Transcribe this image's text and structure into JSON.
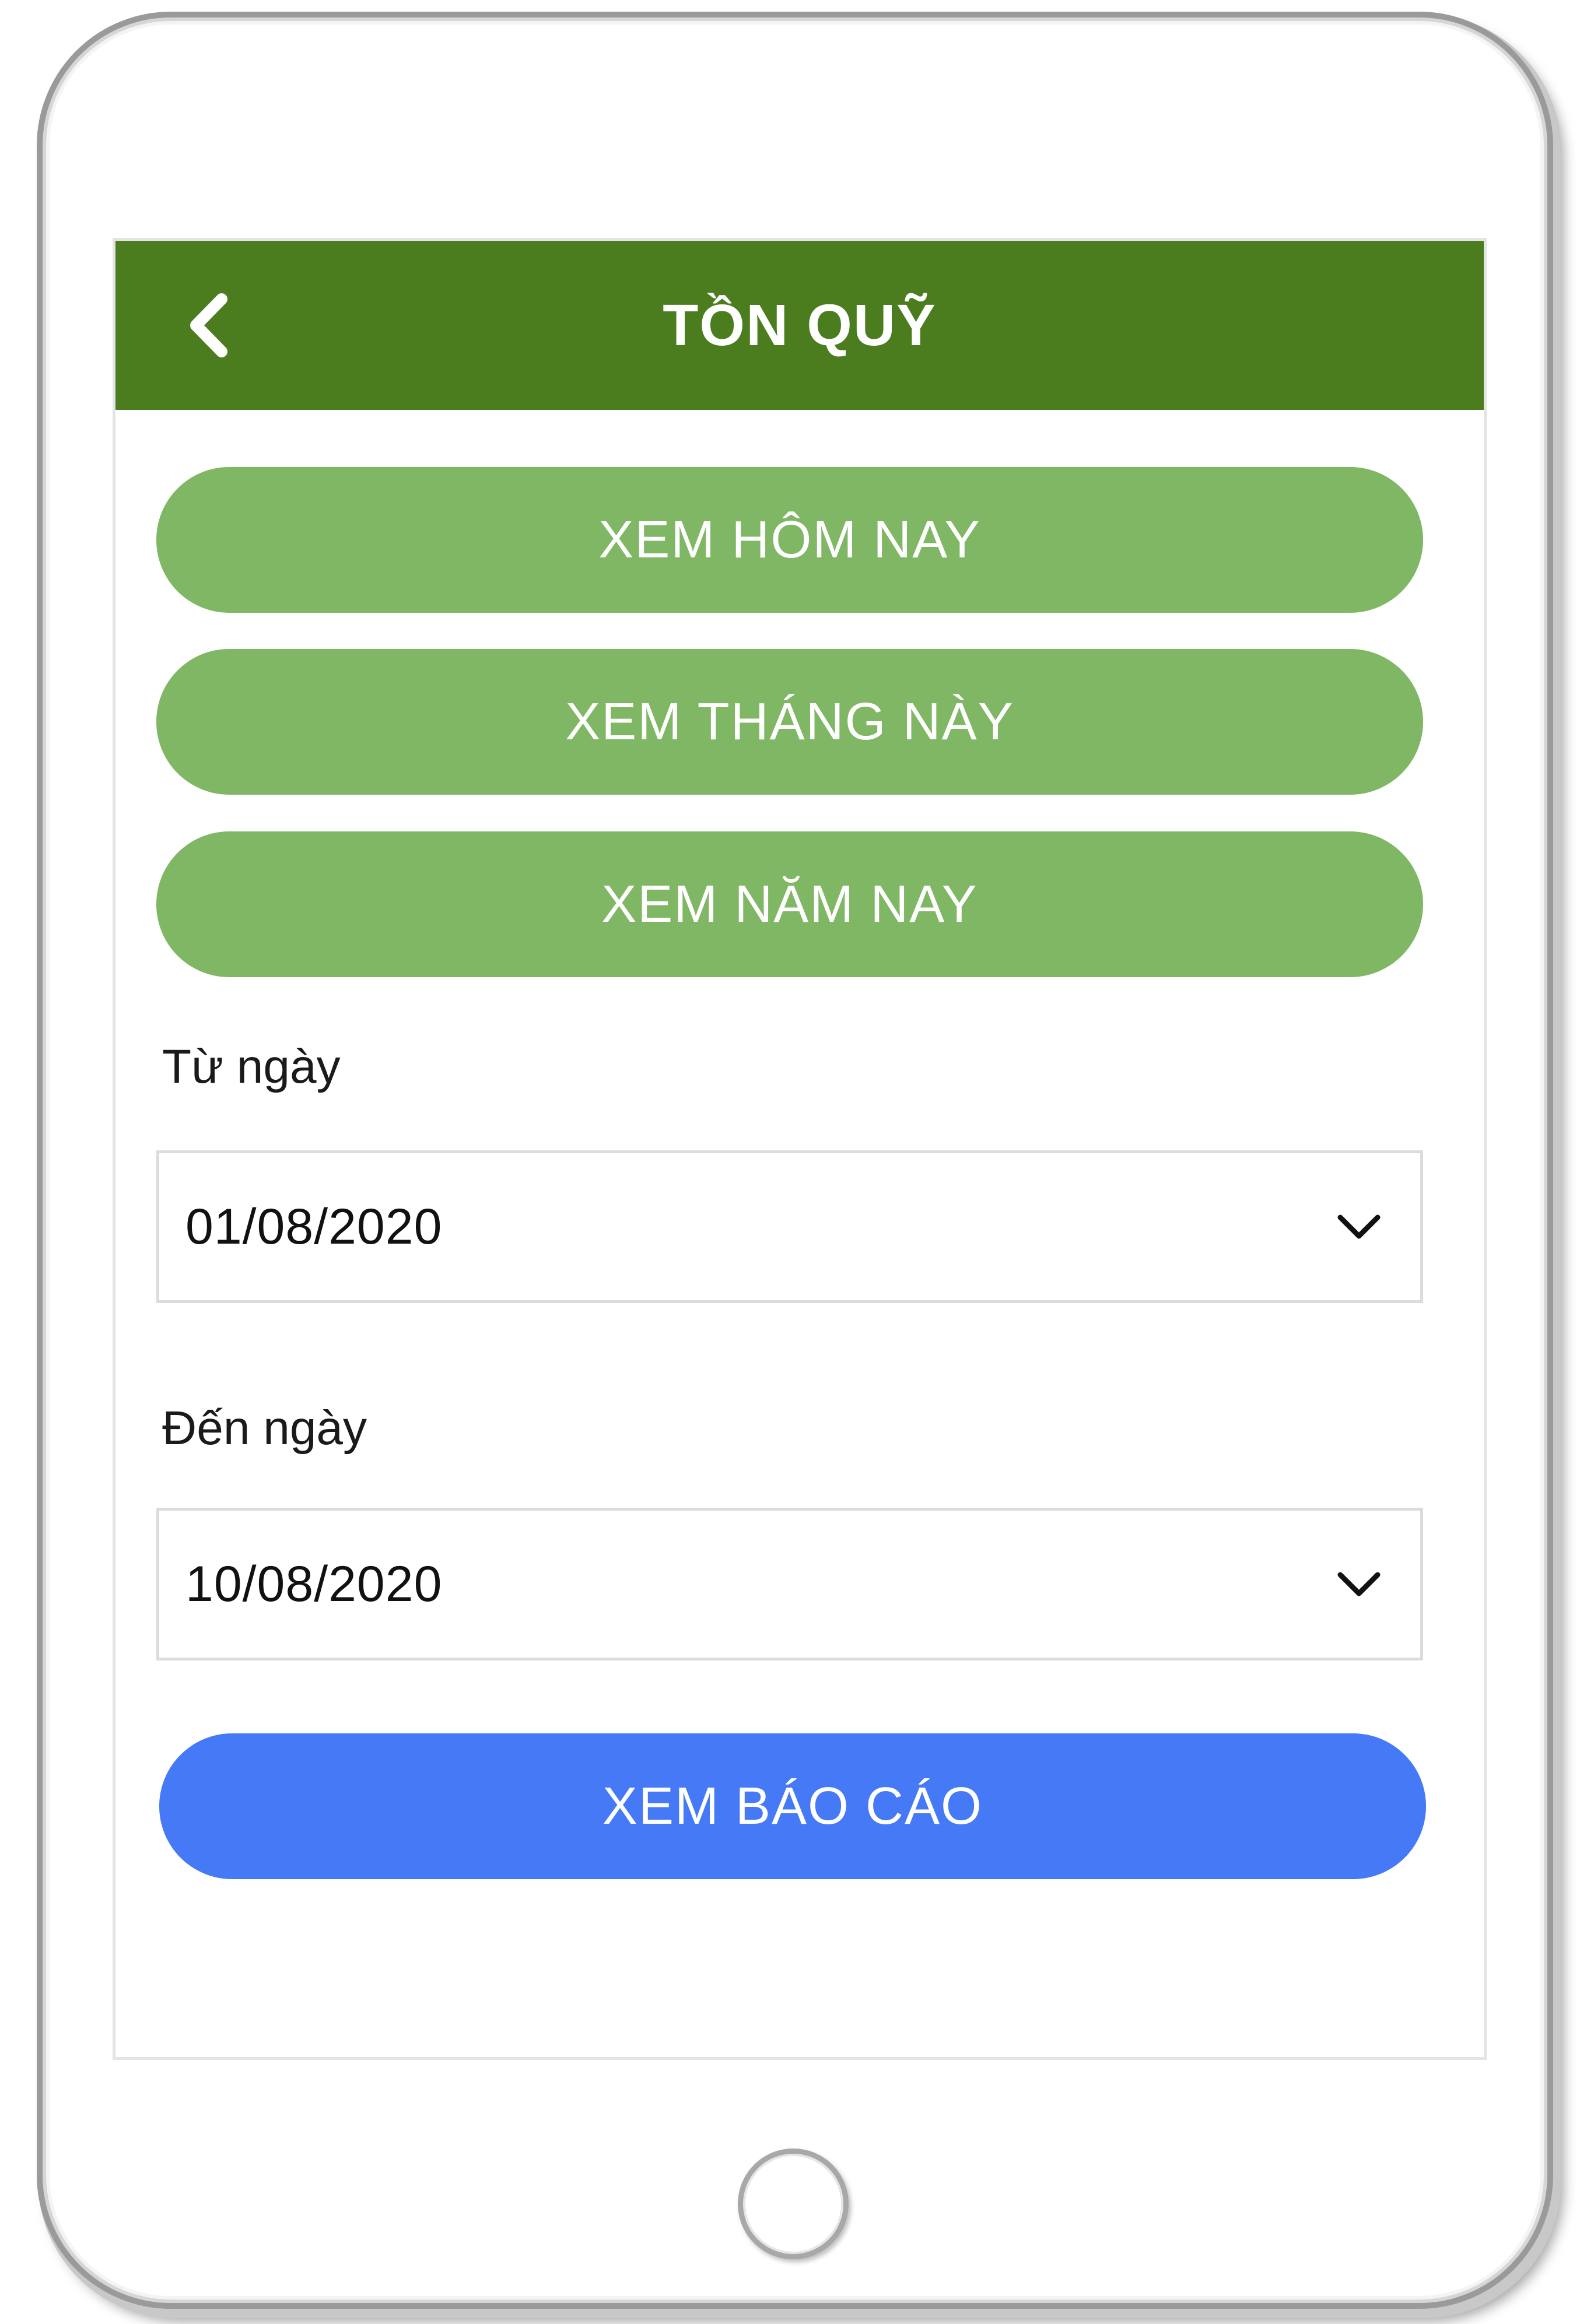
{
  "header": {
    "title": "TỒN QUỸ",
    "back_icon": "chevron-left-icon"
  },
  "quick_filters": {
    "today_label": "XEM HÔM NAY",
    "this_month_label": "XEM THÁNG NÀY",
    "this_year_label": "XEM NĂM NAY"
  },
  "from_date": {
    "label": "Từ ngày",
    "value": "01/08/2020",
    "icon": "chevron-down-icon"
  },
  "to_date": {
    "label": "Đến ngày",
    "value": "10/08/2020",
    "icon": "chevron-down-icon"
  },
  "report_button": {
    "label": "XEM BÁO CÁO"
  },
  "colors": {
    "header": "#4b7d1f",
    "filter_button": "#80b764",
    "report_button": "#4579f5"
  }
}
